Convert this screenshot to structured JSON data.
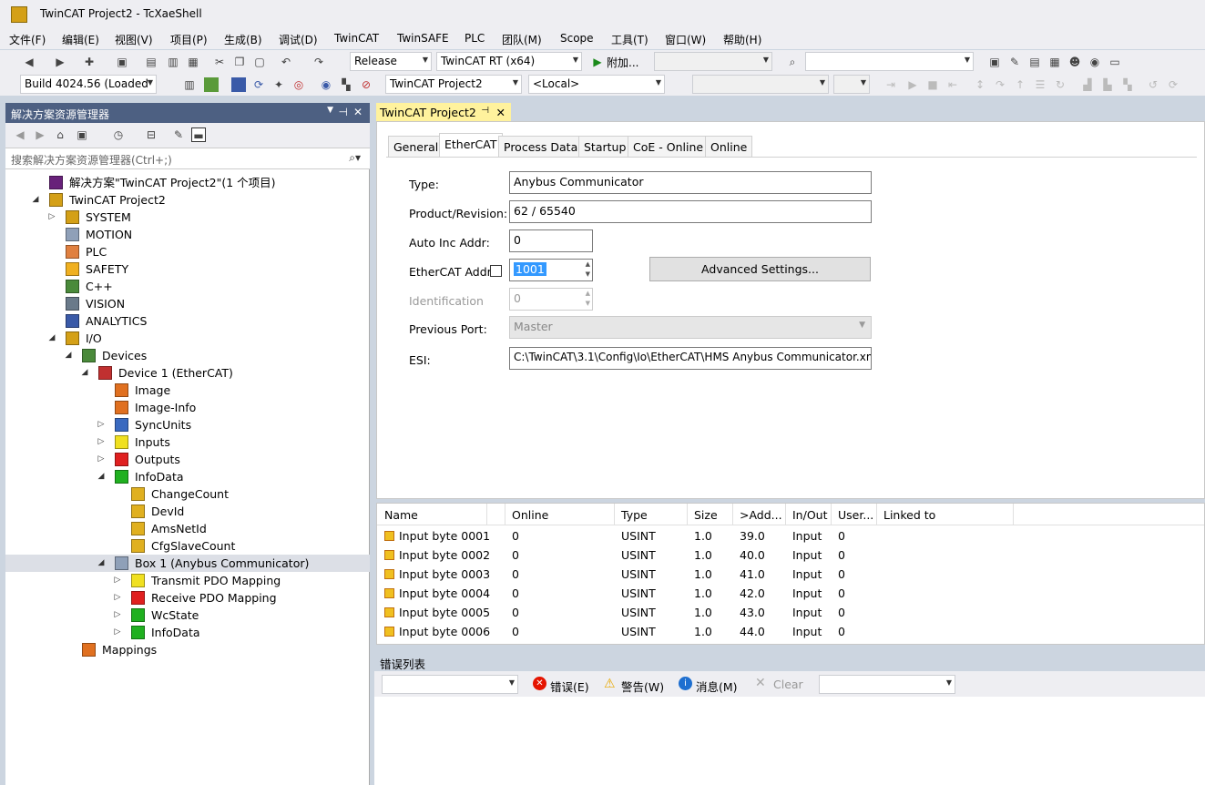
{
  "window": {
    "title": "TwinCAT Project2 - TcXaeShell"
  },
  "menu": [
    "文件(F)",
    "编辑(E)",
    "视图(V)",
    "项目(P)",
    "生成(B)",
    "调试(D)",
    "TwinCAT",
    "TwinSAFE",
    "PLC",
    "团队(M)",
    "Scope",
    "工具(T)",
    "窗口(W)",
    "帮助(H)"
  ],
  "toolbar1": {
    "config": "Release",
    "platform": "TwinCAT RT (x64)",
    "attach": "附加..."
  },
  "toolbar2": {
    "build": "Build 4024.56 (Loaded",
    "project": "TwinCAT Project2",
    "target": "<Local>"
  },
  "solution": {
    "title": "解决方案资源管理器",
    "search_placeholder": "搜索解决方案资源管理器(Ctrl+;)",
    "tree": [
      {
        "label": "解决方案\"TwinCAT Project2\"(1 个项目)",
        "level": 0,
        "exp": "",
        "icon": "solution-icon",
        "color": "#68217a"
      },
      {
        "label": "TwinCAT Project2",
        "level": 0,
        "exp": "◢",
        "icon": "project-icon",
        "color": "#d4a017"
      },
      {
        "label": "SYSTEM",
        "level": 1,
        "exp": "▷",
        "icon": "system-icon",
        "color": "#d4a017"
      },
      {
        "label": "MOTION",
        "level": 1,
        "exp": "",
        "icon": "motion-icon",
        "color": "#8fa0b8"
      },
      {
        "label": "PLC",
        "level": 1,
        "exp": "",
        "icon": "plc-icon",
        "color": "#e08040"
      },
      {
        "label": "SAFETY",
        "level": 1,
        "exp": "",
        "icon": "safety-icon",
        "color": "#f0b020"
      },
      {
        "label": "C++",
        "level": 1,
        "exp": "",
        "icon": "cpp-icon",
        "color": "#4a8a3a"
      },
      {
        "label": "VISION",
        "level": 1,
        "exp": "",
        "icon": "vision-icon",
        "color": "#6a7a8a"
      },
      {
        "label": "ANALYTICS",
        "level": 1,
        "exp": "",
        "icon": "analytics-icon",
        "color": "#3a5aa8"
      },
      {
        "label": "I/O",
        "level": 1,
        "exp": "◢",
        "icon": "io-icon",
        "color": "#d4a017"
      },
      {
        "label": "Devices",
        "level": 2,
        "exp": "◢",
        "icon": "devices-icon",
        "color": "#4a8a3a"
      },
      {
        "label": "Device 1 (EtherCAT)",
        "level": 3,
        "exp": "◢",
        "icon": "ethercat-device-icon",
        "color": "#c03030"
      },
      {
        "label": "Image",
        "level": 4,
        "exp": "",
        "icon": "image-icon",
        "color": "#e07020"
      },
      {
        "label": "Image-Info",
        "level": 4,
        "exp": "",
        "icon": "image-info-icon",
        "color": "#e07020"
      },
      {
        "label": "SyncUnits",
        "level": 4,
        "exp": "▷",
        "icon": "syncunits-icon",
        "color": "#3a6ac0"
      },
      {
        "label": "Inputs",
        "level": 4,
        "exp": "▷",
        "icon": "inputs-icon",
        "color": "#f0e020"
      },
      {
        "label": "Outputs",
        "level": 4,
        "exp": "▷",
        "icon": "outputs-icon",
        "color": "#e02020"
      },
      {
        "label": "InfoData",
        "level": 4,
        "exp": "◢",
        "icon": "infodata-icon",
        "color": "#20b020"
      },
      {
        "label": "ChangeCount",
        "level": 5,
        "exp": "",
        "icon": "var-icon",
        "color": "#e0b020"
      },
      {
        "label": "DevId",
        "level": 5,
        "exp": "",
        "icon": "var-icon",
        "color": "#e0b020"
      },
      {
        "label": "AmsNetId",
        "level": 5,
        "exp": "",
        "icon": "var-icon",
        "color": "#e0b020"
      },
      {
        "label": "CfgSlaveCount",
        "level": 5,
        "exp": "",
        "icon": "var-icon",
        "color": "#e0b020"
      },
      {
        "label": "Box 1 (Anybus Communicator)",
        "level": 4,
        "exp": "◢",
        "icon": "box-icon",
        "color": "#8fa0b8",
        "selected": true
      },
      {
        "label": "Transmit PDO Mapping",
        "level": 5,
        "exp": "▷",
        "icon": "tx-pdo-icon",
        "color": "#f0e020"
      },
      {
        "label": "Receive PDO Mapping",
        "level": 5,
        "exp": "▷",
        "icon": "rx-pdo-icon",
        "color": "#e02020"
      },
      {
        "label": "WcState",
        "level": 5,
        "exp": "▷",
        "icon": "wcstate-icon",
        "color": "#20b020"
      },
      {
        "label": "InfoData",
        "level": 5,
        "exp": "▷",
        "icon": "infodata-icon",
        "color": "#20b020"
      },
      {
        "label": "Mappings",
        "level": 2,
        "exp": "",
        "icon": "mappings-icon",
        "color": "#e07020"
      }
    ]
  },
  "editor": {
    "doc_tab": "TwinCAT Project2",
    "tabs": [
      "General",
      "EtherCAT",
      "Process Data",
      "Startup",
      "CoE - Online",
      "Online"
    ],
    "active_tab": "EtherCAT",
    "fields": {
      "type_label": "Type:",
      "type_value": "Anybus Communicator",
      "product_label": "Product/Revision:",
      "product_value": "62 / 65540",
      "autoinc_label": "Auto Inc Addr:",
      "autoinc_value": "0",
      "ecat_label": "EtherCAT Addr:",
      "ecat_value": "1001",
      "adv_button": "Advanced Settings...",
      "ident_label": "Identification",
      "ident_value": "0",
      "prev_label": "Previous Port:",
      "prev_value": "Master",
      "esi_label": "ESI:",
      "esi_value": "C:\\TwinCAT\\3.1\\Config\\Io\\EtherCAT\\HMS Anybus Communicator.xm"
    }
  },
  "grid": {
    "headers": [
      "Name",
      "Online",
      "Type",
      "Size",
      ">Add...",
      "In/Out",
      "User...",
      "Linked to"
    ],
    "rows": [
      [
        "Input byte 0001",
        "0",
        "USINT",
        "1.0",
        "39.0",
        "Input",
        "0"
      ],
      [
        "Input byte 0002",
        "0",
        "USINT",
        "1.0",
        "40.0",
        "Input",
        "0"
      ],
      [
        "Input byte 0003",
        "0",
        "USINT",
        "1.0",
        "41.0",
        "Input",
        "0"
      ],
      [
        "Input byte 0004",
        "0",
        "USINT",
        "1.0",
        "42.0",
        "Input",
        "0"
      ],
      [
        "Input byte 0005",
        "0",
        "USINT",
        "1.0",
        "43.0",
        "Input",
        "0"
      ],
      [
        "Input byte 0006",
        "0",
        "USINT",
        "1.0",
        "44.0",
        "Input",
        "0"
      ]
    ]
  },
  "errorlist": {
    "title": "错误列表",
    "errors": "错误(E)",
    "warnings": "警告(W)",
    "messages": "消息(M)",
    "clear": "Clear"
  }
}
